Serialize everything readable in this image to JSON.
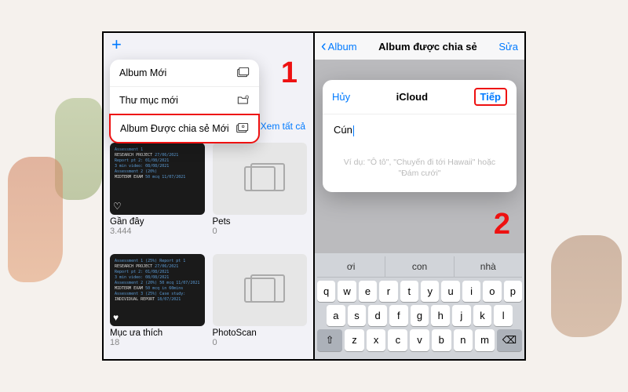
{
  "steps": {
    "one": "1",
    "two": "2"
  },
  "phone1": {
    "menu": {
      "items": [
        {
          "label": "Album Mới"
        },
        {
          "label": "Thư mục mới"
        },
        {
          "label": "Album Được chia sẻ Mới"
        }
      ]
    },
    "see_all": "Xem tất cả",
    "albums": [
      {
        "title": "Gần đây",
        "count": "3.444"
      },
      {
        "title": "Pets",
        "count": "0"
      },
      {
        "title": "Mục ưa thích",
        "count": "18"
      },
      {
        "title": "PhotoScan",
        "count": "0"
      }
    ]
  },
  "phone2": {
    "nav": {
      "back": "Album",
      "title": "Album được chia sẻ",
      "edit": "Sửa"
    },
    "modal": {
      "cancel": "Hủy",
      "title": "iCloud",
      "next": "Tiếp",
      "input_value": "Cún",
      "hint": "Ví dụ: \"Ô tô\", \"Chuyến đi tới Hawaii\" hoặc \"Đám cưới\""
    },
    "keyboard": {
      "suggestions": [
        "ơi",
        "con",
        "nhà"
      ],
      "rows": [
        [
          "q",
          "w",
          "e",
          "r",
          "t",
          "y",
          "u",
          "i",
          "o",
          "p"
        ],
        [
          "a",
          "s",
          "d",
          "f",
          "g",
          "h",
          "j",
          "k",
          "l"
        ],
        [
          "⇧",
          "z",
          "x",
          "c",
          "v",
          "b",
          "n",
          "m",
          "⌫"
        ]
      ]
    }
  }
}
